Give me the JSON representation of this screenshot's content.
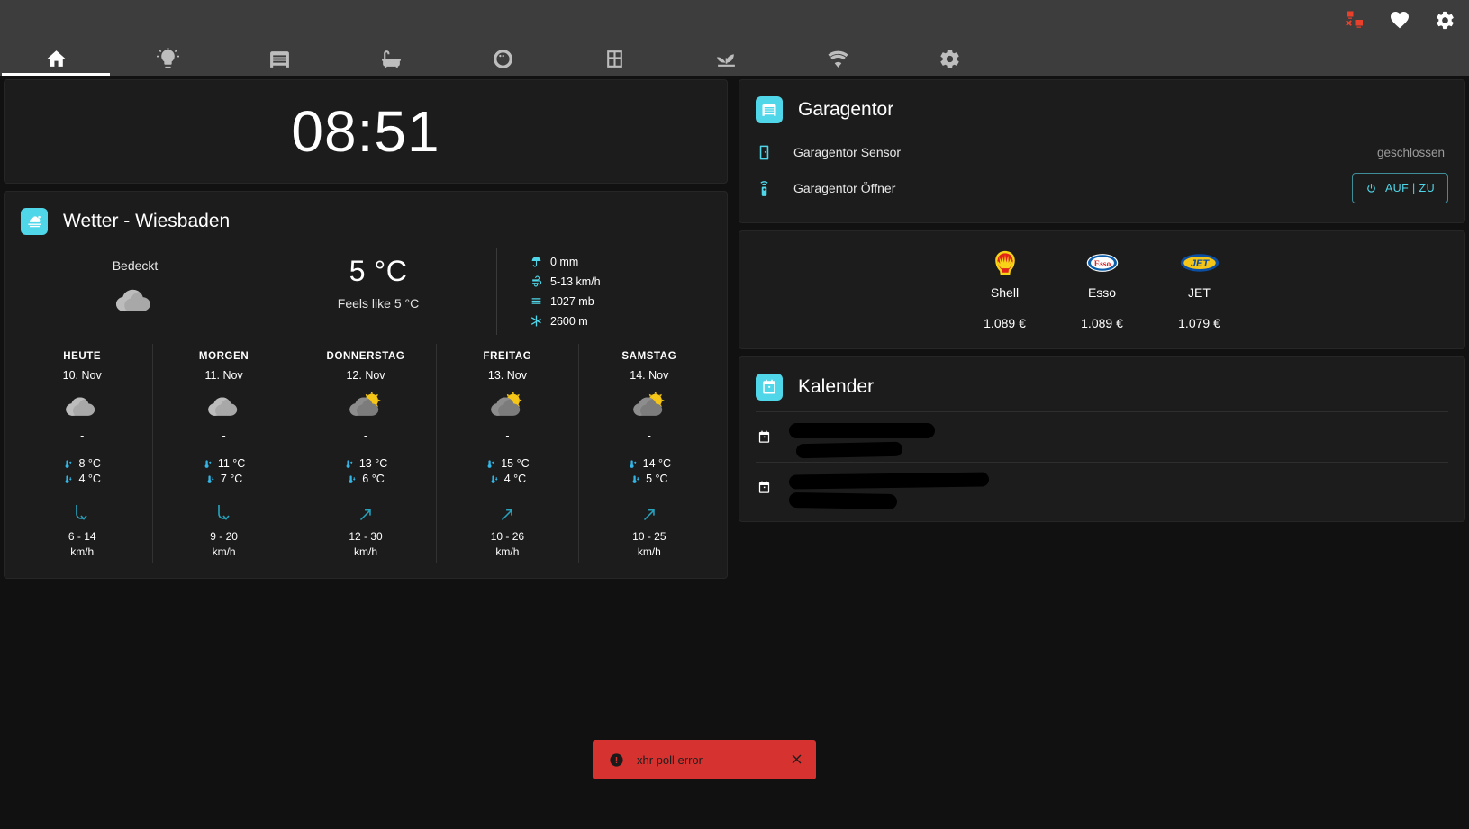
{
  "topbar": {
    "status_icons": [
      {
        "name": "network-off-icon",
        "color": "#e8402a"
      },
      {
        "name": "heart-icon",
        "color": "#ffffff"
      },
      {
        "name": "gear-icon",
        "color": "#ffffff"
      }
    ],
    "tabs": [
      {
        "icon": "home-icon",
        "label": "Home",
        "active": true
      },
      {
        "icon": "lightbulb-icon",
        "label": "Licht",
        "active": false
      },
      {
        "icon": "garage-icon",
        "label": "Garage",
        "active": false
      },
      {
        "icon": "bathtub-icon",
        "label": "Bad",
        "active": false
      },
      {
        "icon": "washing-machine-icon",
        "label": "Waschen",
        "active": false
      },
      {
        "icon": "window-icon",
        "label": "Fenster",
        "active": false
      },
      {
        "icon": "sprout-icon",
        "label": "Pflanzen",
        "active": false
      },
      {
        "icon": "wifi-icon",
        "label": "Netzwerk",
        "active": false
      },
      {
        "icon": "cog-icon",
        "label": "Einstellungen",
        "active": false
      }
    ]
  },
  "clock": {
    "time": "08:51"
  },
  "weather": {
    "title": "Wetter - Wiesbaden",
    "badge_icon": "weather-partly-cloudy-icon",
    "condition": "Bedeckt",
    "condition_icon": "cloudy-icon",
    "temperature": "5 °C",
    "apparent": "Feels like 5 °C",
    "attributes": [
      {
        "icon": "umbrella-icon",
        "value": "0 mm"
      },
      {
        "icon": "wind-icon",
        "value": "5-13 km/h"
      },
      {
        "icon": "gauge-icon",
        "value": "1027 mb"
      },
      {
        "icon": "snowflake-icon",
        "value": "2600 m"
      }
    ],
    "forecast": [
      {
        "name": "HEUTE",
        "date": "10. Nov",
        "icon": "cloudy-icon",
        "precip": "-",
        "high": "8 °C",
        "low": "4 °C",
        "wind": "6 - 14",
        "wind_unit": "km/h",
        "wind_dir": "down"
      },
      {
        "name": "MORGEN",
        "date": "11. Nov",
        "icon": "cloudy-icon",
        "precip": "-",
        "high": "11 °C",
        "low": "7 °C",
        "wind": "9 - 20",
        "wind_unit": "km/h",
        "wind_dir": "down"
      },
      {
        "name": "DONNERSTAG",
        "date": "12. Nov",
        "icon": "partly-cloudy-icon",
        "precip": "-",
        "high": "13 °C",
        "low": "6 °C",
        "wind": "12 - 30",
        "wind_unit": "km/h",
        "wind_dir": "up-right"
      },
      {
        "name": "FREITAG",
        "date": "13. Nov",
        "icon": "partly-cloudy-icon",
        "precip": "-",
        "high": "15 °C",
        "low": "4 °C",
        "wind": "10 - 26",
        "wind_unit": "km/h",
        "wind_dir": "up-right"
      },
      {
        "name": "SAMSTAG",
        "date": "14. Nov",
        "icon": "partly-cloudy-icon",
        "precip": "-",
        "high": "14 °C",
        "low": "5 °C",
        "wind": "10 - 25",
        "wind_unit": "km/h",
        "wind_dir": "up-right"
      }
    ]
  },
  "garage": {
    "title": "Garagentor",
    "badge_icon": "garage-icon",
    "rows": [
      {
        "icon": "door-icon",
        "name": "Garagentor Sensor",
        "state": "geschlossen"
      },
      {
        "icon": "remote-icon",
        "name": "Garagentor Öffner",
        "button": "AUF | ZU",
        "button_icon": "power-icon"
      }
    ]
  },
  "fuel": {
    "stations": [
      {
        "brand": "Shell",
        "price": "1.089 €",
        "logo": "shell-logo"
      },
      {
        "brand": "Esso",
        "price": "1.089 €",
        "logo": "esso-logo"
      },
      {
        "brand": "JET",
        "price": "1.079 €",
        "logo": "jet-logo"
      }
    ]
  },
  "calendar": {
    "title": "Kalender",
    "badge_icon": "calendar-icon",
    "events": [
      {
        "icon": "calendar-icon",
        "summary": "",
        "time": "",
        "redacted": true
      },
      {
        "icon": "calendar-icon",
        "summary": "",
        "time": "",
        "redacted": true
      }
    ]
  },
  "toast": {
    "icon": "alert-circle-icon",
    "message": "xhr poll error",
    "close_icon": "close-icon"
  },
  "colors": {
    "accent": "#4fd6e8",
    "topbar": "#3d3d3d",
    "card": "#1c1c1c",
    "background": "#111111",
    "error": "#d63230"
  }
}
